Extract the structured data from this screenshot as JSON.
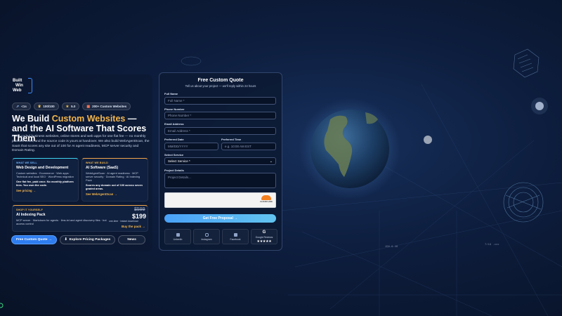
{
  "brand": {
    "logo_lines": [
      "Built",
      "Win",
      "Web"
    ]
  },
  "badges": [
    {
      "icon": "arrow-icon",
      "text": "<1s"
    },
    {
      "icon": "trophy-icon",
      "text": "100/100"
    },
    {
      "icon": "star-icon",
      "text": "5.0"
    },
    {
      "icon": "grid-icon",
      "text": "200+ Custom Websites"
    }
  ],
  "hero": {
    "headline_part1": "We Build ",
    "headline_accent": "Custom Websites",
    "headline_part2": " — and the AI Software That Scores Them",
    "lede": "Hand-coded business websites, online stores and web apps for one flat fee — no monthly platform costs, and the source code is yours at handover. We also build WebAgentScan, the SaaS that scores any site out of 100 for AI agent readiness, MCP server security and Domain Rating."
  },
  "cards": {
    "sell": {
      "kicker": "WHAT WE SELL",
      "title": "Web Design and Development",
      "body": "Custom websites · Ecommerce · Web apps · Technical and local SEO · WordPress migration",
      "bold": "One flat fee, paid once. No monthly platform fees. You own the code.",
      "link": "See pricing →"
    },
    "build": {
      "kicker": "WHAT WE BUILD",
      "title": "AI Software (SaaS)",
      "body": "WebAgentScan · AI agent readiness · MCP server security · Domain Rating · AI Indexing Pack",
      "bold": "Scores any domain out of 100 across seven graded areas.",
      "link": "See WebAgentScan →"
    },
    "shop": {
      "kicker": "SHOP IT YOURSELF",
      "title": "AI Indexing Pack",
      "body": "MCP server · Markdown for agents · llms.txt and agent discovery files · bot access control",
      "old_price": "$599",
      "price": "$199",
      "price_note": "one-time · instant download",
      "link": "Buy the pack →"
    }
  },
  "buttons": {
    "quote": "Free Custom Quote →",
    "pricing": "Explore Pricing Packages",
    "news": "News"
  },
  "form": {
    "title": "Free Custom Quote",
    "subtitle": "Tell us about your project — we'll reply within 24 hours",
    "full_name_label": "Full Name",
    "full_name_placeholder": "Full Name *",
    "phone_label": "Phone Number",
    "phone_placeholder": "Phone Number *",
    "email_label": "Email Address",
    "email_placeholder": "Email Address *",
    "date_label": "Preferred Date",
    "date_placeholder": "MM/DD/YYYY",
    "time_label": "Preferred Time",
    "time_placeholder": "e.g. 10:00 AM EST",
    "service_label": "Select Service",
    "service_value": "Select Service *",
    "details_label": "Project Details",
    "details_placeholder": "Project Details...",
    "captcha_brand": "CLOUDFLARE",
    "submit": "Get Free Proposal →"
  },
  "socials": [
    {
      "label": "LinkedIn"
    },
    {
      "label": "Instagram"
    },
    {
      "label": "Facebook"
    },
    {
      "label": "Google Reviews",
      "stars": "★★★★★"
    }
  ],
  "globe_tags": [
    "156.9.46",
    "7/19 .xxx"
  ],
  "colors": {
    "accent_blue": "#2f7df0",
    "accent_orange": "#f3b64b",
    "cloudflare": "#f38020"
  }
}
